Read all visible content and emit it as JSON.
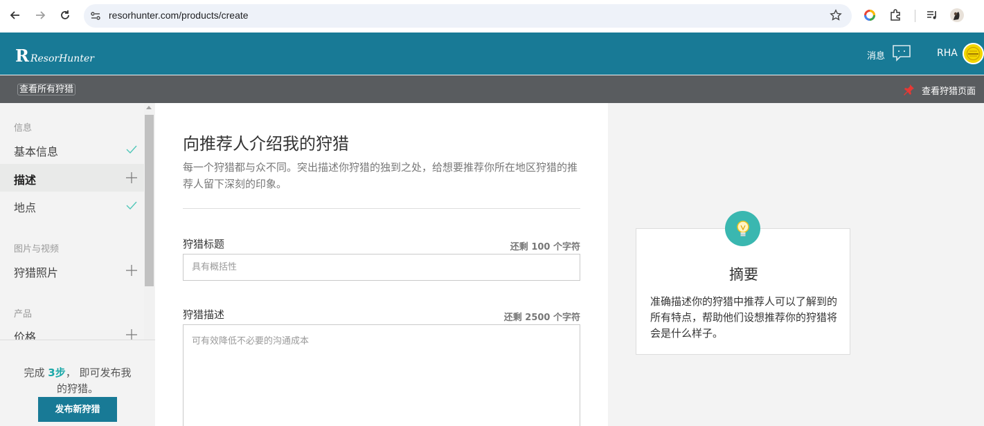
{
  "browser": {
    "url": "resorhunter.com/products/create"
  },
  "header": {
    "logo_letter": "R",
    "logo_text": "ResorHunter",
    "messages_label": "消息",
    "user_name": "RHA"
  },
  "subbar": {
    "view_all": "查看所有狩猎",
    "view_page": "查看狩猎页面"
  },
  "sidebar": {
    "sections": [
      {
        "heading": "信息",
        "items": [
          {
            "label": "基本信息",
            "status": "done"
          },
          {
            "label": "描述",
            "status": "add",
            "active": true
          },
          {
            "label": "地点",
            "status": "done"
          }
        ]
      },
      {
        "heading": "图片与视频",
        "items": [
          {
            "label": "狩猎照片",
            "status": "add"
          }
        ]
      },
      {
        "heading": "产品",
        "items": [
          {
            "label": "价格",
            "status": "add"
          }
        ]
      }
    ],
    "footer": {
      "text_before": "完成 ",
      "steps": "3步",
      "text_after": "， 即可发布我的狩猎。",
      "publish_button": "发布新狩猎"
    }
  },
  "main": {
    "title": "向推荐人介绍我的狩猎",
    "intro": "每一个狩猎都与众不同。突出描述你狩猎的独到之处，给想要推荐你所在地区狩猎的推荐人留下深刻的印象。",
    "title_field": {
      "label": "狩猎标题",
      "count_text": "还剩 100 个字符",
      "placeholder": "具有概括性"
    },
    "desc_field": {
      "label": "狩猎描述",
      "count_text": "还剩 2500 个字符",
      "placeholder": "可有效降低不必要的沟通成本"
    }
  },
  "tip": {
    "icon": "lightbulb-icon",
    "title": "摘要",
    "text": "准确描述你的狩猎中推荐人可以了解到的所有特点，帮助他们设想推荐你的狩猎将会是什么样子。"
  },
  "colors": {
    "header": "#187a96",
    "subbar": "#595c5f",
    "accent": "#3ab7b0",
    "check": "#4fc7b8"
  }
}
